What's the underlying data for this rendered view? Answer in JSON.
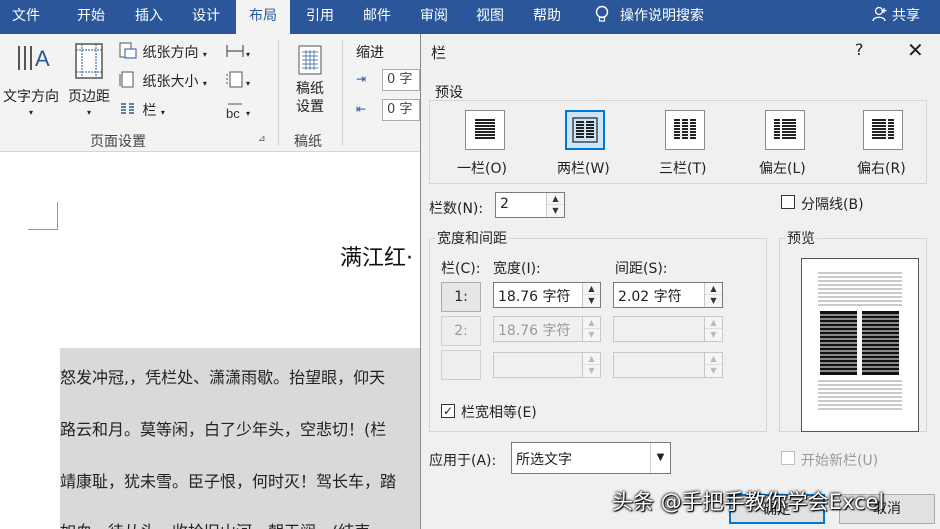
{
  "tabs": [
    "文件",
    "开始",
    "插入",
    "设计",
    "布局",
    "引用",
    "邮件",
    "审阅",
    "视图",
    "帮助"
  ],
  "active_tab": "布局",
  "tell_me": "操作说明搜索",
  "share": "共享",
  "ribbon": {
    "text_direction": "文字方向",
    "margins": "页边距",
    "orientation": "纸张方向",
    "size": "纸张大小",
    "columns": "栏",
    "page_setup_group": "页面设置",
    "paper_setup": "稿纸\n设置",
    "paper_group": "稿纸",
    "indent": "缩进",
    "indent_left": "0 字",
    "indent_right": "0 字"
  },
  "document": {
    "title": "满江红·",
    "lines": [
      "怒发冲冠,，凭栏处、潇潇雨歇。抬望眼，仰天",
      "路云和月。莫等闲，白了少年头，空悲切！(栏",
      "靖康耻，犹未雪。臣子恨，何时灭！驾长车，踏",
      "如血，待从头，收拾旧山河，朝天阙。(结束"
    ]
  },
  "dialog": {
    "title": "栏",
    "help": "?",
    "close": "✕",
    "presets_label": "预设",
    "presets": [
      "一栏(O)",
      "两栏(W)",
      "三栏(T)",
      "偏左(L)",
      "偏右(R)"
    ],
    "selected_preset": "两栏(W)",
    "num_cols_label": "栏数(N):",
    "num_cols": "2",
    "separator_label": "分隔线(B)",
    "width_spacing_label": "宽度和间距",
    "col_header": "栏(C):",
    "width_header": "宽度(I):",
    "spacing_header": "间距(S):",
    "rows": [
      {
        "col": "1:",
        "width": "18.76 字符",
        "spacing": "2.02 字符"
      },
      {
        "col": "2:",
        "width": "18.76 字符",
        "spacing": ""
      },
      {
        "col": "",
        "width": "",
        "spacing": ""
      }
    ],
    "equal_width_label": "栏宽相等(E)",
    "preview_label": "预览",
    "apply_to_label": "应用于(A):",
    "apply_to": "所选文字",
    "new_col_label": "开始新栏(U)",
    "ok": "确定",
    "cancel": "取消"
  },
  "watermark": "头条 @手把手教你学会Excel"
}
